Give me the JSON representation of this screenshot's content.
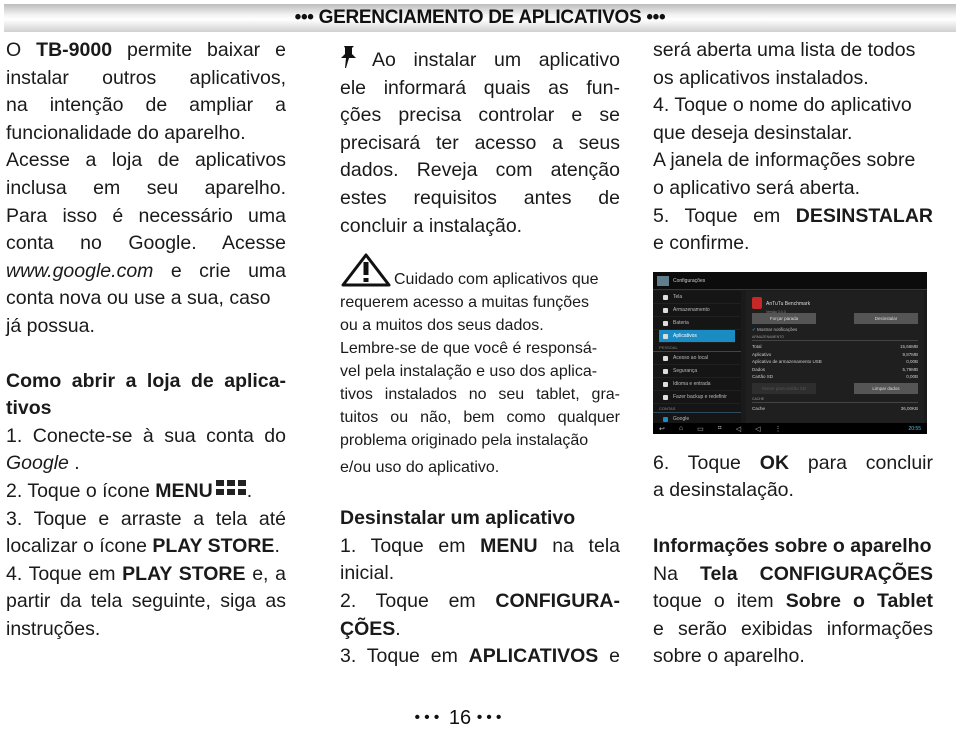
{
  "header": {
    "title": "••• GERENCIAMENTO DE APLICATIVOS •••"
  },
  "column1": {
    "intro_lines": [
      {
        "pre": "O ",
        "bold": "TB-9000",
        "post": " permite baixar e"
      },
      {
        "text": "instalar outros aplicativos,"
      },
      {
        "text": "na intenção de ampliar a"
      },
      {
        "text": "funcionalidade do aparelho."
      },
      {
        "text": "Acesse a loja de aplicativos"
      },
      {
        "text": "inclusa em seu aparelho."
      },
      {
        "text": "Para isso é necessário uma"
      },
      {
        "text": "conta no Google. Acesse"
      },
      {
        "italic": "www.google.com",
        "post": " e crie uma"
      },
      {
        "text": "conta nova ou use a sua, caso"
      },
      {
        "text": "já possua."
      }
    ],
    "section_title_line1": "Como abrir a loja de aplica-",
    "section_title_line2": "tivos",
    "steps": {
      "s1_text": "1. Conecte-se à sua conta do",
      "s1_italic": "Google",
      "s1_end": " .",
      "s2_pre": "2. Toque o ícone ",
      "s2_bold": "MENU",
      "s2_end": ".",
      "s3_line1": "3. Toque e arraste a tela até",
      "s3_pre": "localizar o ícone ",
      "s3_bold": "PLAY STORE",
      "s3_end": ".",
      "s4_pre": "4. Toque em ",
      "s4_bold": "PLAY STORE",
      "s4_post": " e, a",
      "s4_line2": "partir da tela seguinte, siga as",
      "s4_line3": "instruções."
    }
  },
  "column2": {
    "note_lines": [
      "Ao instalar um aplicativo",
      "ele informará quais as fun-",
      "ções precisa controlar e se",
      "precisará ter acesso a seus",
      "dados. Reveja com  atenção",
      "estes requisitos antes de",
      "concluir a instalação."
    ],
    "warning_lines": [
      "Cuidado com aplicativos que",
      "requerem acesso a muitas funções",
      "ou a muitos dos seus dados.",
      "Lembre-se de que você é responsá-",
      "vel pela instalação e uso dos aplica-",
      "tivos instalados no seu tablet, gra-",
      "tuitos ou não, bem como qualquer",
      "problema originado pela instalação",
      "e/ou uso do aplicativo."
    ],
    "uninstall_title": "Desinstalar um aplicativo",
    "uninstall": {
      "s1_pre": "1. Toque em ",
      "s1_bold": "MENU",
      "s1_post": " na tela",
      "s1_line2": "inicial.",
      "s2_pre": "2. Toque em ",
      "s2_bold": "CONFIGURA-",
      "s2_bold2": "ÇÕES",
      "s2_end": ".",
      "s3_pre": "3. Toque em ",
      "s3_bold": "APLICATIVOS",
      "s3_post": " e"
    }
  },
  "column3": {
    "lines": [
      "será aberta uma lista de todos",
      "os aplicativos instalados.",
      "4. Toque o nome do aplicativo",
      "que deseja desinstalar.",
      "A janela de informações sobre",
      "o aplicativo será aberta."
    ],
    "s5_pre": "5. Toque em ",
    "s5_bold": "DESINSTALAR",
    "s5_line2": "e confirme.",
    "s6_pre": "6. Toque ",
    "s6_bold": "OK",
    "s6_post": " para concluir",
    "s6_line2": "a desinstalação.",
    "info_title": "Informações sobre o aparelho",
    "info_pre": "Na ",
    "info_bold1": "Tela",
    "info_bold2": "CONFIGURAÇÕES",
    "info_l2_pre": "toque o item ",
    "info_l2_bold": "Sobre o Tablet",
    "info_l3": "e serão exibidas informações",
    "info_l4": "sobre o aparelho."
  },
  "screenshot": {
    "title": "Configurações",
    "sidebar": [
      {
        "label": "Tela",
        "active": false
      },
      {
        "label": "Armazenamento",
        "active": false
      },
      {
        "label": "Bateria",
        "active": false
      },
      {
        "label": "Aplicativos",
        "active": true
      }
    ],
    "section_personal": "PESSOAL",
    "sidebar2": [
      {
        "label": "Acesso ao local"
      },
      {
        "label": "Segurança"
      },
      {
        "label": "Idioma e entrada"
      },
      {
        "label": "Fazer backup e redefinir"
      }
    ],
    "section_accounts": "CONTAS",
    "sidebar3": [
      {
        "label": "Google"
      }
    ],
    "app_name": "AnTuTu Benchmark",
    "app_version": "Versão 3.0.3",
    "btn_force_stop": "Forçar parada",
    "btn_uninstall": "Desinstalar",
    "show_notifications": "Mostrar notificações",
    "storage_section": "ARMAZENAMENTO",
    "storage_rows": [
      {
        "label": "Total",
        "value": "15,66MB"
      },
      {
        "label": "Aplicativo",
        "value": "9,87MB"
      },
      {
        "label": "Aplicativo de armazenamento USB",
        "value": "0,00B"
      },
      {
        "label": "Dados",
        "value": "5,79MB"
      },
      {
        "label": "Cartão SD",
        "value": "0,00B"
      }
    ],
    "btn_move": "Mover para cartão SD",
    "btn_clear_data": "Limpar dados",
    "cache_section": "CACHE",
    "cache_rows": [
      {
        "label": "Cache",
        "value": "36,00KB"
      }
    ],
    "clock": "20:55"
  },
  "footer": {
    "page_number": "16",
    "bullets": "•••"
  }
}
